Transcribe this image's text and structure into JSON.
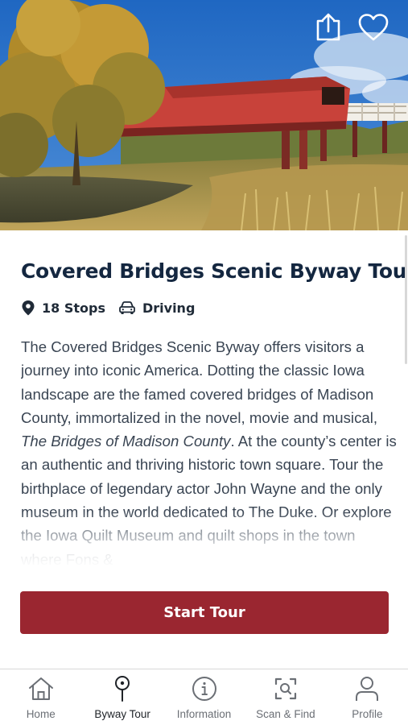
{
  "tour": {
    "title": "Covered Bridges Scenic Byway Tour",
    "stops": "18 Stops",
    "mode": "Driving",
    "description_before": "The Covered Bridges Scenic Byway offers visitors a journey into iconic America. Dotting the classic Iowa landscape are the famed covered bridges of Madison County, immortalized in the novel, movie and musical, ",
    "description_italic": "The Bridges of Madison County",
    "description_after": ". At the county’s center is an authentic and thriving historic town square. Tour the birthplace of legendary actor John Wayne and the only museum in the world dedicated to The Duke. Or explore the Iowa Quilt Museum and quilt shops in the town where Fons &"
  },
  "actions": {
    "start_label": "Start Tour"
  },
  "hero_icons": {
    "share": "share-icon",
    "favorite": "heart-icon"
  },
  "tabs": [
    {
      "label": "Home",
      "icon": "home-icon"
    },
    {
      "label": "Byway Tour",
      "icon": "map-pin-icon",
      "active": true
    },
    {
      "label": "Information",
      "icon": "info-icon"
    },
    {
      "label": "Scan & Find",
      "icon": "scan-icon"
    },
    {
      "label": "Profile",
      "icon": "profile-icon"
    }
  ],
  "colors": {
    "accent": "#9a2630",
    "title": "#142740",
    "text": "#3a4553",
    "bridge": "#c8423a"
  }
}
